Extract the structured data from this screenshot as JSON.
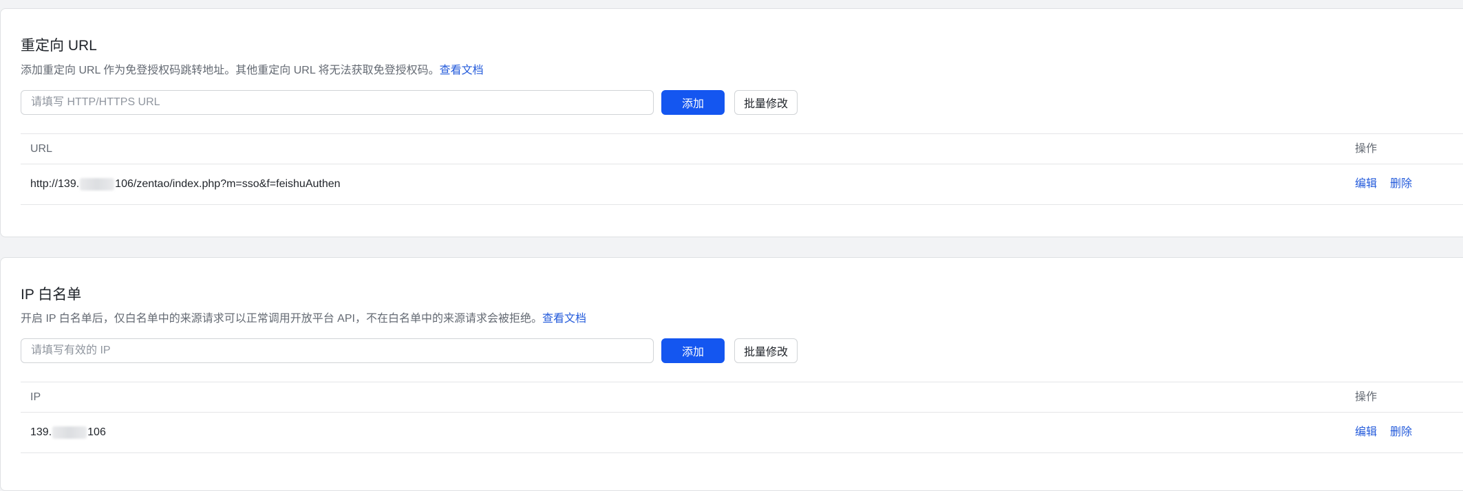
{
  "redirect_section": {
    "title": "重定向 URL",
    "description": "添加重定向 URL 作为免登授权码跳转地址。其他重定向 URL 将无法获取免登授权码。",
    "doc_link": "查看文档",
    "input_placeholder": "请填写 HTTP/HTTPS URL",
    "input_value": "",
    "add_button": "添加",
    "bulk_edit_button": "批量修改",
    "table": {
      "columns": [
        "URL",
        "操作"
      ],
      "rows": [
        {
          "value_prefix": "http://139.",
          "value_suffix": "106/zentao/index.php?m=sso&f=feishuAuthen",
          "actions": [
            "编辑",
            "删除"
          ]
        }
      ]
    }
  },
  "ip_section": {
    "title": "IP 白名单",
    "description": "开启 IP 白名单后，仅白名单中的来源请求可以正常调用开放平台 API，不在白名单中的来源请求会被拒绝。",
    "doc_link": "查看文档",
    "input_placeholder": "请填写有效的 IP",
    "input_value": "",
    "add_button": "添加",
    "bulk_edit_button": "批量修改",
    "table": {
      "columns": [
        "IP",
        "操作"
      ],
      "rows": [
        {
          "value_prefix": "139.",
          "value_suffix": "106",
          "actions": [
            "编辑",
            "删除"
          ]
        }
      ]
    }
  },
  "colors": {
    "primary": "#1456f0",
    "link": "#245bdb",
    "text": "#1f2329",
    "secondary_text": "#646a73",
    "background": "#f2f3f5"
  }
}
